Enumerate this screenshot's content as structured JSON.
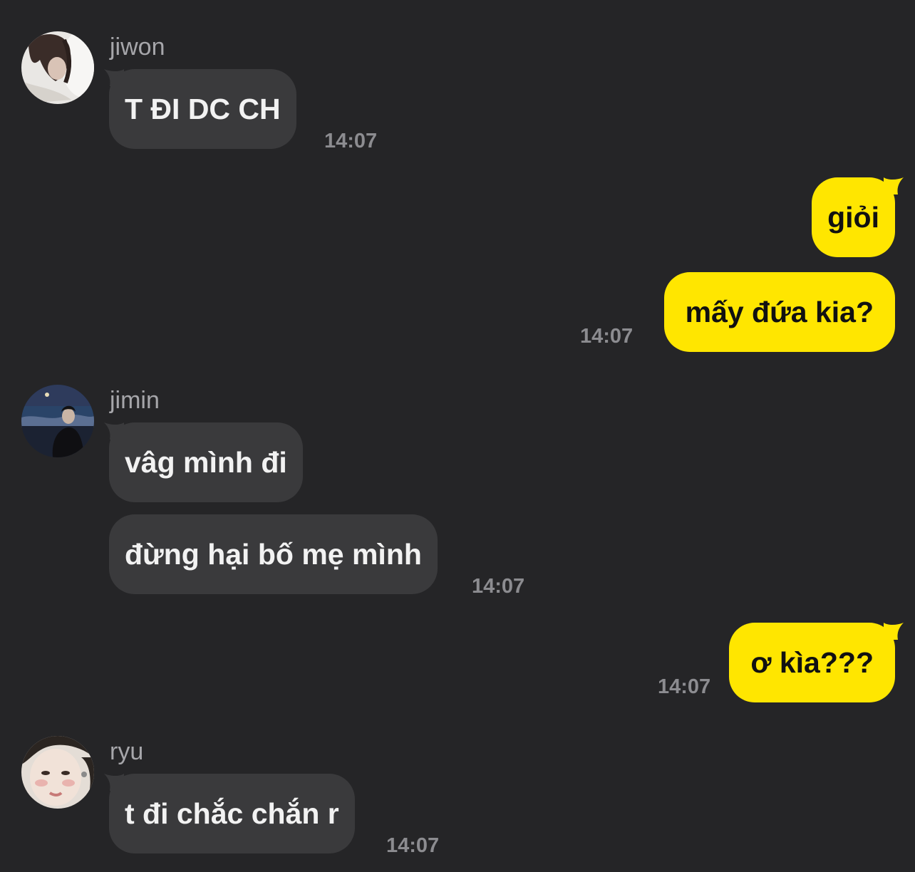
{
  "colors": {
    "background": "#252527",
    "incoming_bubble": "#3a3a3c",
    "outgoing_bubble": "#ffe600",
    "timestamp": "#8c8c90",
    "sender_name": "#a6a6aa"
  },
  "messages": [
    {
      "sender": "jiwon",
      "avatar": "jiwon-avatar",
      "bubbles": [
        {
          "text": "T ĐI DC CH"
        }
      ],
      "time": "14:07"
    },
    {
      "sender": "me",
      "bubbles": [
        {
          "text": "giỏi"
        },
        {
          "text": "mấy đứa kia?"
        }
      ],
      "time": "14:07"
    },
    {
      "sender": "jimin",
      "avatar": "jimin-avatar",
      "bubbles": [
        {
          "text": "vâg mình đi"
        },
        {
          "text": "đừng hại bố mẹ mình"
        }
      ],
      "time": "14:07"
    },
    {
      "sender": "me",
      "bubbles": [
        {
          "text": "ơ kìa???"
        }
      ],
      "time": "14:07"
    },
    {
      "sender": "ryu",
      "avatar": "ryu-avatar",
      "bubbles": [
        {
          "text": "t đi chắc chắn r"
        }
      ],
      "time": "14:07"
    }
  ]
}
